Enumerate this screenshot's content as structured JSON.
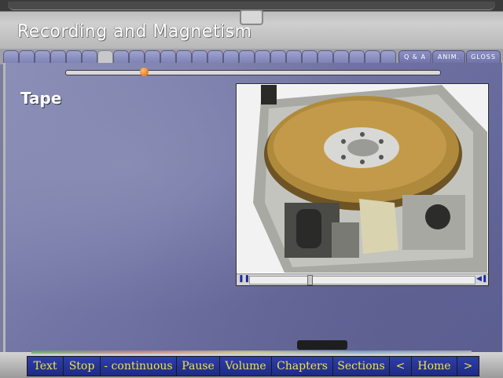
{
  "app_title": "Recording and Magnetism",
  "tabs": {
    "count": 25,
    "active_index": 6
  },
  "right_tabs": [
    "Q & A",
    "ANIM.",
    "GLOSS"
  ],
  "progress": {
    "fraction": 0.21
  },
  "section_heading": "Tape",
  "video": {
    "icons": [
      "pause-icon",
      "volume-icon"
    ],
    "position_fraction": 0.26
  },
  "nav": {
    "text": "Text",
    "stop": "Stop",
    "continuous": "- continuous",
    "pause": "Pause",
    "volume": "Volume",
    "chapters": "Chapters",
    "sections": "Sections",
    "prev": "<",
    "home": "Home",
    "next": ">"
  },
  "colors": {
    "nav_button": "#1d2a86",
    "nav_text": "#f0e24a",
    "progress_knob": "#e35c00",
    "content_bg": "#6f72a2"
  }
}
